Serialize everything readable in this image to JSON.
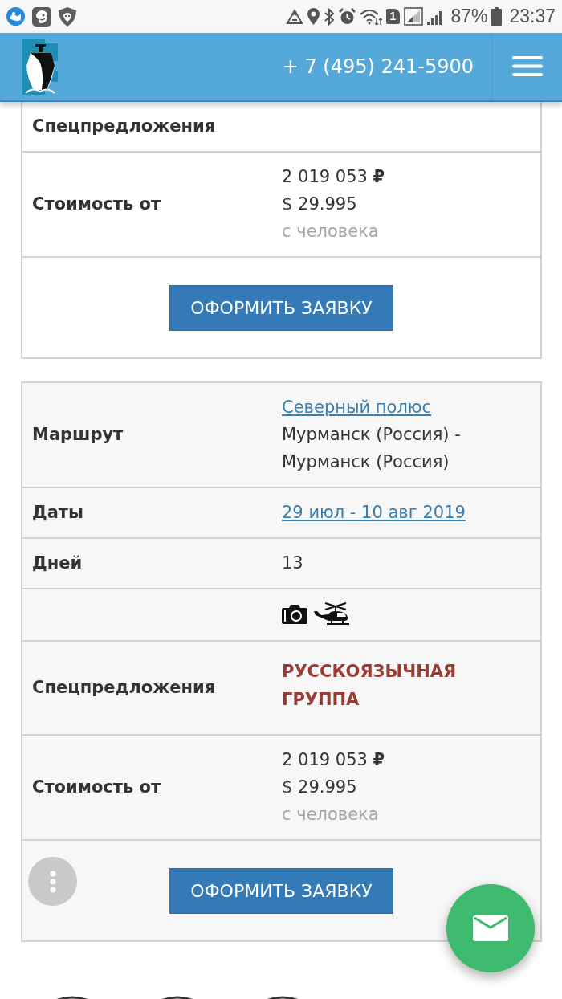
{
  "status_bar": {
    "sim_slot": "1",
    "battery": "87%",
    "time": "23:37"
  },
  "header": {
    "phone": "+ 7 (495) 241-5900"
  },
  "cards": [
    {
      "rows": [
        {
          "kind": "text",
          "label": "Спецпредложения"
        },
        {
          "kind": "price",
          "label": "Стоимость от",
          "price_rub": "2 019 053 **₽**",
          "price_usd": "$ 29.995",
          "note": "с человека"
        }
      ],
      "button": "ОФОРМИТЬ ЗАЯВКУ"
    },
    {
      "rows": [
        {
          "kind": "route",
          "label": "Маршрут",
          "link": "Северный полюс",
          "text": "Мурманск (Россия) - Мурманск (Россия)"
        },
        {
          "kind": "link",
          "label": "Даты",
          "link": "29 июл - 10 авг 2019"
        },
        {
          "kind": "text",
          "label": "Дней",
          "text": "13"
        },
        {
          "kind": "icons"
        },
        {
          "kind": "offer",
          "label": "Спецпредложения",
          "text": "РУССКОЯЗЫЧНАЯ ГРУППА"
        },
        {
          "kind": "price",
          "label": "Стоимость от",
          "price_rub": "2 019 053 **₽**",
          "price_usd": "$ 29.995",
          "note": "с человека"
        }
      ],
      "button": "ОФОРМИТЬ ЗАЯВКУ"
    }
  ]
}
